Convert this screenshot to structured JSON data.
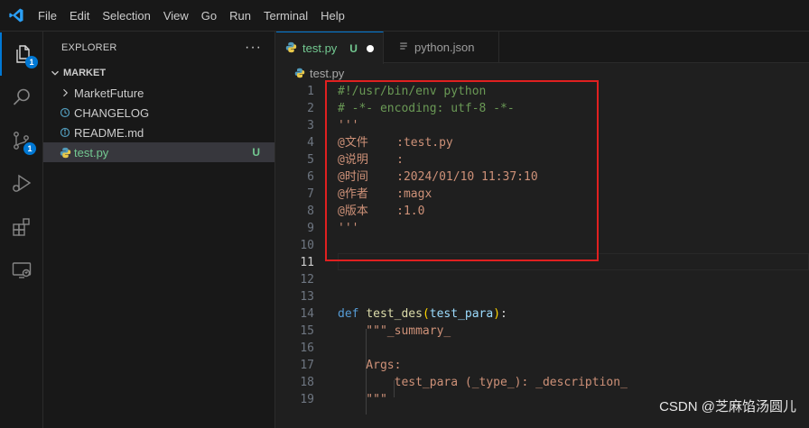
{
  "menu": [
    "File",
    "Edit",
    "Selection",
    "View",
    "Go",
    "Run",
    "Terminal",
    "Help"
  ],
  "activity": {
    "explorer_badge": "1",
    "scm_badge": "1"
  },
  "sidebar": {
    "title": "EXPLORER",
    "more": "···",
    "folder": "MARKET",
    "items": [
      {
        "label": "MarketFuture",
        "kind": "folder"
      },
      {
        "label": "CHANGELOG",
        "kind": "file"
      },
      {
        "label": "README.md",
        "kind": "info"
      },
      {
        "label": "test.py",
        "kind": "python",
        "status": "U"
      }
    ]
  },
  "tabs": [
    {
      "label": "test.py",
      "status": "U",
      "active": true
    },
    {
      "label": "python.json",
      "active": false
    }
  ],
  "breadcrumb": "test.py",
  "editor": {
    "lines": [
      {
        "n": "1",
        "text": "#!/usr/bin/env python"
      },
      {
        "n": "2",
        "text": "# -*- encoding: utf-8 -*-"
      },
      {
        "n": "3",
        "text": "'''"
      },
      {
        "n": "4",
        "text": "@文件    :test.py"
      },
      {
        "n": "5",
        "text": "@说明    :"
      },
      {
        "n": "6",
        "text": "@时间    :2024/01/10 11:37:10"
      },
      {
        "n": "7",
        "text": "@作者    :magx"
      },
      {
        "n": "8",
        "text": "@版本    :1.0"
      },
      {
        "n": "9",
        "text": "'''"
      },
      {
        "n": "10",
        "text": ""
      },
      {
        "n": "11",
        "text": ""
      },
      {
        "n": "12",
        "text": ""
      },
      {
        "n": "13",
        "text": ""
      },
      {
        "n": "14",
        "kw": "def",
        "fn": "test_des",
        "p1": "(",
        "param": "test_para",
        "p2": ")",
        "colon": ":"
      },
      {
        "n": "15",
        "text": "    \"\"\"_summary_"
      },
      {
        "n": "16",
        "text": ""
      },
      {
        "n": "17",
        "text": "    Args:"
      },
      {
        "n": "18",
        "text": "        test_para (_type_): _description_"
      },
      {
        "n": "19",
        "text": "    \"\"\""
      }
    ]
  },
  "watermark": "CSDN @芝麻馅汤圆儿",
  "colors": {
    "accent": "#0078d4",
    "untracked": "#73c991",
    "highlight": "#e02020"
  }
}
